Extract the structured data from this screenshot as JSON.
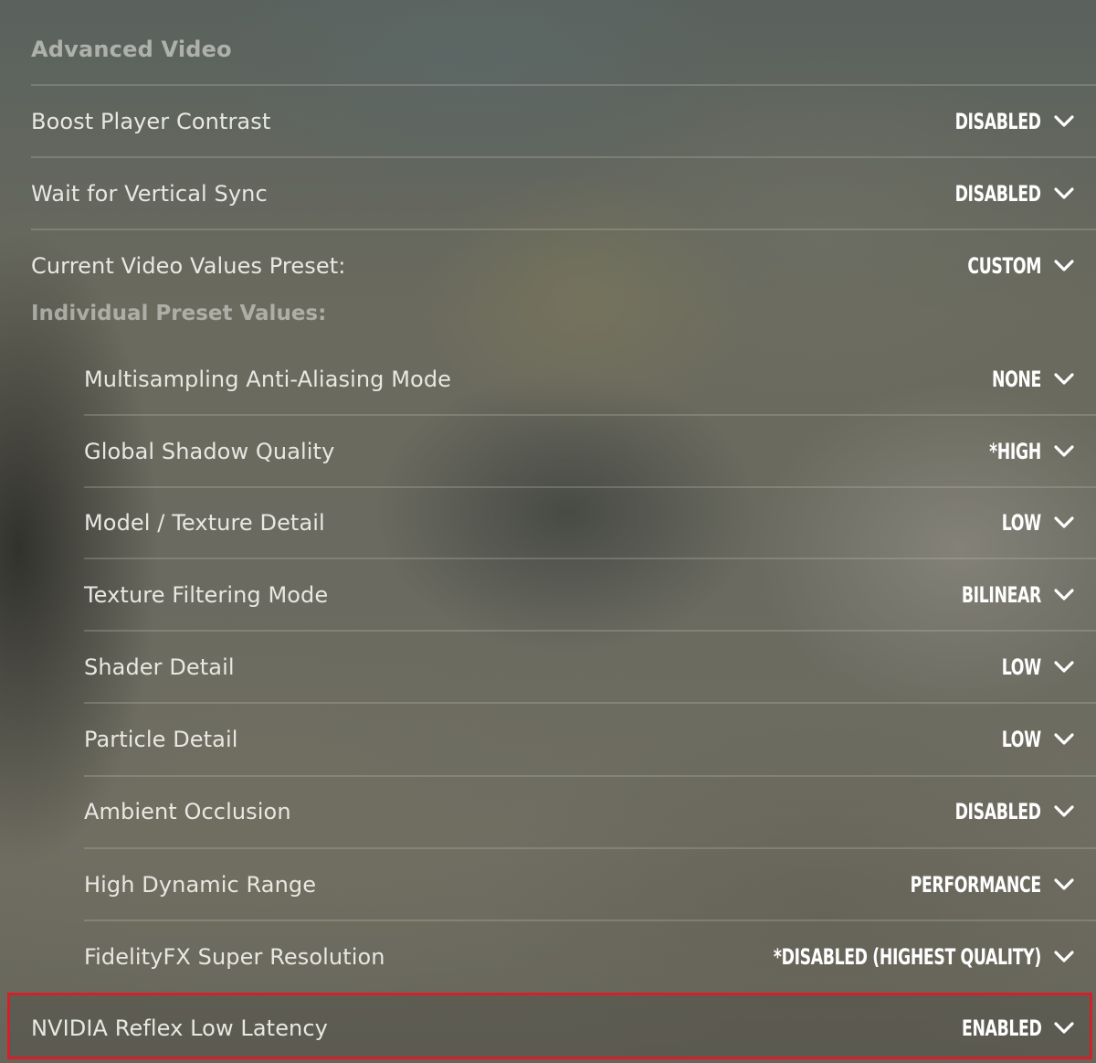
{
  "section_title": "Advanced Video",
  "subheading": "Individual Preset Values:",
  "top_settings": [
    {
      "label": "Boost Player Contrast",
      "value": "DISABLED"
    },
    {
      "label": "Wait for Vertical Sync",
      "value": "DISABLED"
    },
    {
      "label": "Current Video Values Preset:",
      "value": "CUSTOM"
    }
  ],
  "preset_settings": [
    {
      "label": "Multisampling Anti-Aliasing Mode",
      "value": "NONE"
    },
    {
      "label": "Global Shadow Quality",
      "value": "*HIGH"
    },
    {
      "label": "Model / Texture Detail",
      "value": "LOW"
    },
    {
      "label": "Texture Filtering Mode",
      "value": "BILINEAR"
    },
    {
      "label": "Shader Detail",
      "value": "LOW"
    },
    {
      "label": "Particle Detail",
      "value": "LOW"
    },
    {
      "label": "Ambient Occlusion",
      "value": "DISABLED"
    },
    {
      "label": "High Dynamic Range",
      "value": "PERFORMANCE"
    },
    {
      "label": "FidelityFX Super Resolution",
      "value": "*DISABLED (HIGHEST QUALITY)"
    }
  ],
  "highlighted_setting": {
    "label": "NVIDIA Reflex Low Latency",
    "value": "ENABLED"
  },
  "colors": {
    "highlight_border": "#d4202a",
    "value_text": "#ffffff",
    "label_text": "#e8e8e2"
  },
  "icons": {
    "dropdown": "chevron-down-icon"
  }
}
